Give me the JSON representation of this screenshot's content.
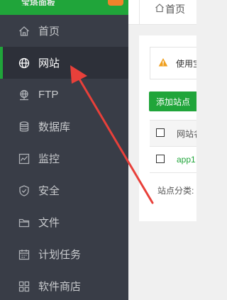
{
  "brand": {
    "name": "宝塔面板"
  },
  "sidebar": {
    "items": [
      {
        "label": "首页",
        "icon": "home-icon"
      },
      {
        "label": "网站",
        "icon": "globe-icon",
        "active": true
      },
      {
        "label": "FTP",
        "icon": "ftp-icon"
      },
      {
        "label": "数据库",
        "icon": "database-icon"
      },
      {
        "label": "监控",
        "icon": "monitor-icon"
      },
      {
        "label": "安全",
        "icon": "shield-icon"
      },
      {
        "label": "文件",
        "icon": "folder-icon"
      },
      {
        "label": "计划任务",
        "icon": "calendar-icon"
      },
      {
        "label": "软件商店",
        "icon": "apps-grid-icon"
      }
    ]
  },
  "breadcrumb": {
    "label": "首页"
  },
  "notice": {
    "text": "使用宝"
  },
  "toolbar": {
    "add_site_label": "添加站点"
  },
  "table": {
    "headers": [
      "网站名"
    ],
    "rows": [
      {
        "name": "app1"
      }
    ]
  },
  "footer": {
    "category_label": "站点分类:"
  },
  "colors": {
    "sidebar_bg": "#393d47",
    "accent": "#20a53a",
    "annotation_arrow": "#e8403a",
    "warning": "#f0a020"
  }
}
